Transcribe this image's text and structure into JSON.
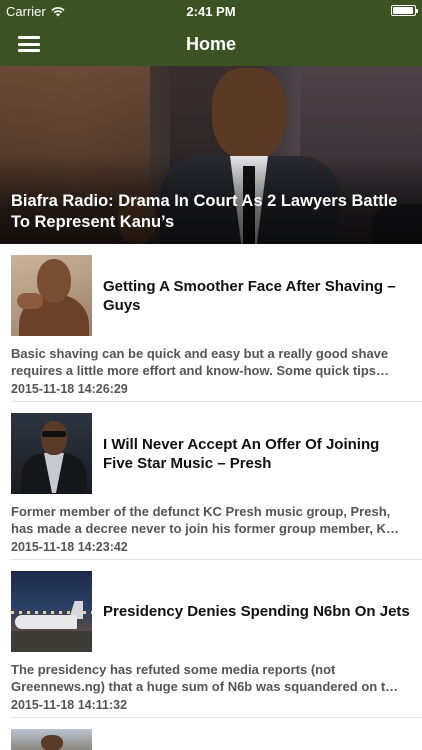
{
  "status_bar": {
    "carrier": "Carrier",
    "time": "2:41 PM"
  },
  "nav": {
    "title": "Home",
    "menu_icon": "hamburger-menu-icon"
  },
  "hero": {
    "title": "Biafra Radio: Drama In Court As 2 Lawyers Battle To Represent Kanu’s"
  },
  "articles": [
    {
      "title": "Getting A Smoother Face After Shaving – Guys",
      "summary": "Basic shaving can be quick and easy but a really good shave requires a little more effort and know-how. Some quick tips…",
      "date": "2015-11-18 14:26:29"
    },
    {
      "title": "I Will Never Accept An Offer Of Joining Five Star Music – Presh",
      "summary": "Former member of the defunct KC Presh music group, Presh, has made a decree never to join  his former group member, K…",
      "date": "2015-11-18 14:23:42"
    },
    {
      "title": "Presidency Denies Spending N6bn On Jets",
      "summary": "The presidency has refuted some media reports (not Greennews.ng) that a huge sum of N6b was squandered on t…",
      "date": "2015-11-18 14:11:32"
    }
  ],
  "colors": {
    "bar_green": "#3b5323",
    "text_dark": "#111111",
    "text_muted": "#555555"
  }
}
